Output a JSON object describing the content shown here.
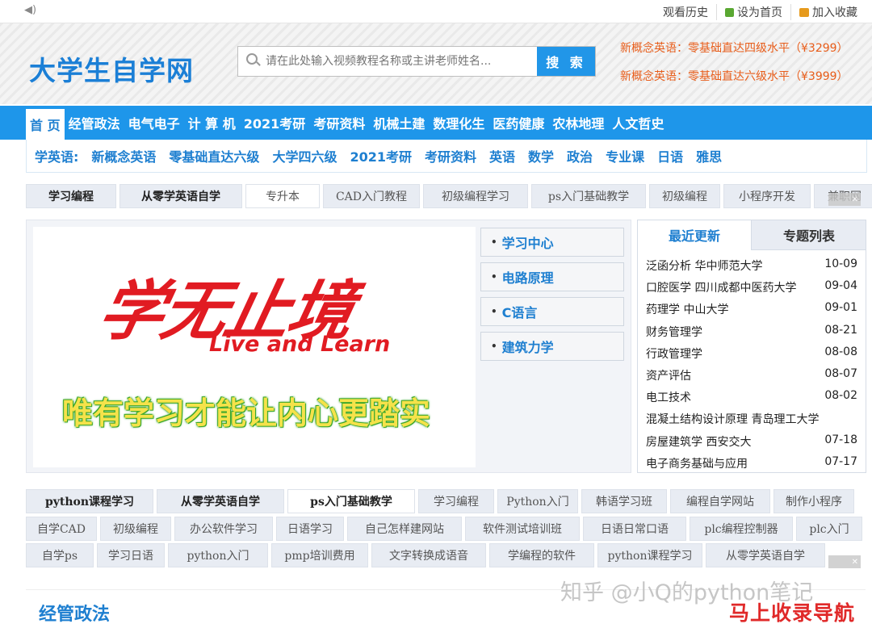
{
  "topbar": {
    "history": "观看历史",
    "set_home": "设为首页",
    "favorite": "加入收藏"
  },
  "header": {
    "logo": "大学生自学网",
    "search_placeholder": "请在此处输入视频教程名称或主讲老师姓名...",
    "search_button": "搜 索",
    "promo1": "新概念英语：零基础直达四级水平（¥3299）",
    "promo2": "新概念英语：零基础直达六级水平（¥3999）"
  },
  "nav_main": [
    "首 页",
    "经管政法",
    "电气电子",
    "计 算 机",
    "2021考研",
    "考研资料",
    "机械土建",
    "数理化生",
    "医药健康",
    "农林地理",
    "人文哲史"
  ],
  "nav_sub": [
    "学英语:",
    "新概念英语",
    "零基础直达六级",
    "大学四六级",
    "2021考研",
    "考研资料",
    "英语",
    "数学",
    "政治",
    "专业课",
    "日语",
    "雅思"
  ],
  "tags_top": [
    "学习编程",
    "从零学英语自学",
    "专升本",
    "CAD入门教程",
    "初级编程学习",
    "ps入门基础教学",
    "初级编程",
    "小程序开发",
    "兼职网"
  ],
  "banner": {
    "chinese": "学无止境",
    "english": "Live and Learn",
    "slogan": "唯有学习才能让内心更踏实"
  },
  "side_links": [
    "学习中心",
    "电路原理",
    "C语言",
    "建筑力学"
  ],
  "news_tabs": [
    "最近更新",
    "专题列表"
  ],
  "news": [
    {
      "title": "泛函分析 华中师范大学",
      "date": "10-09"
    },
    {
      "title": "口腔医学 四川成都中医药大学",
      "date": "09-04"
    },
    {
      "title": "药理学 中山大学",
      "date": "09-01"
    },
    {
      "title": "财务管理学",
      "date": "08-21"
    },
    {
      "title": "行政管理学",
      "date": "08-08"
    },
    {
      "title": "资产评估",
      "date": "08-07"
    },
    {
      "title": "电工技术",
      "date": "08-02"
    },
    {
      "title": "混凝土结构设计原理 青岛理工大学",
      "date": ""
    },
    {
      "title": "房屋建筑学 西安交大",
      "date": "07-18"
    },
    {
      "title": "电子商务基础与应用",
      "date": "07-17"
    }
  ],
  "tags_row1": [
    "python课程学习",
    "从零学英语自学",
    "ps入门基础教学",
    "学习编程",
    "Python入门",
    "韩语学习班",
    "编程自学网站",
    "制作小程序"
  ],
  "tags_row2": [
    "自学CAD",
    "初级编程",
    "办公软件学习",
    "日语学习",
    "自己怎样建网站",
    "软件测试培训班",
    "日语日常口语",
    "plc编程控制器",
    "plc入门"
  ],
  "tags_row3": [
    "自学ps",
    "学习日语",
    "python入门",
    "pmp培训费用",
    "文字转换成语音",
    "学编程的软件",
    "python课程学习",
    "从零学英语自学"
  ],
  "section_title": "经管政法",
  "watermark": "知乎 @小Q的python笔记",
  "watermark2": "马上收录导航"
}
